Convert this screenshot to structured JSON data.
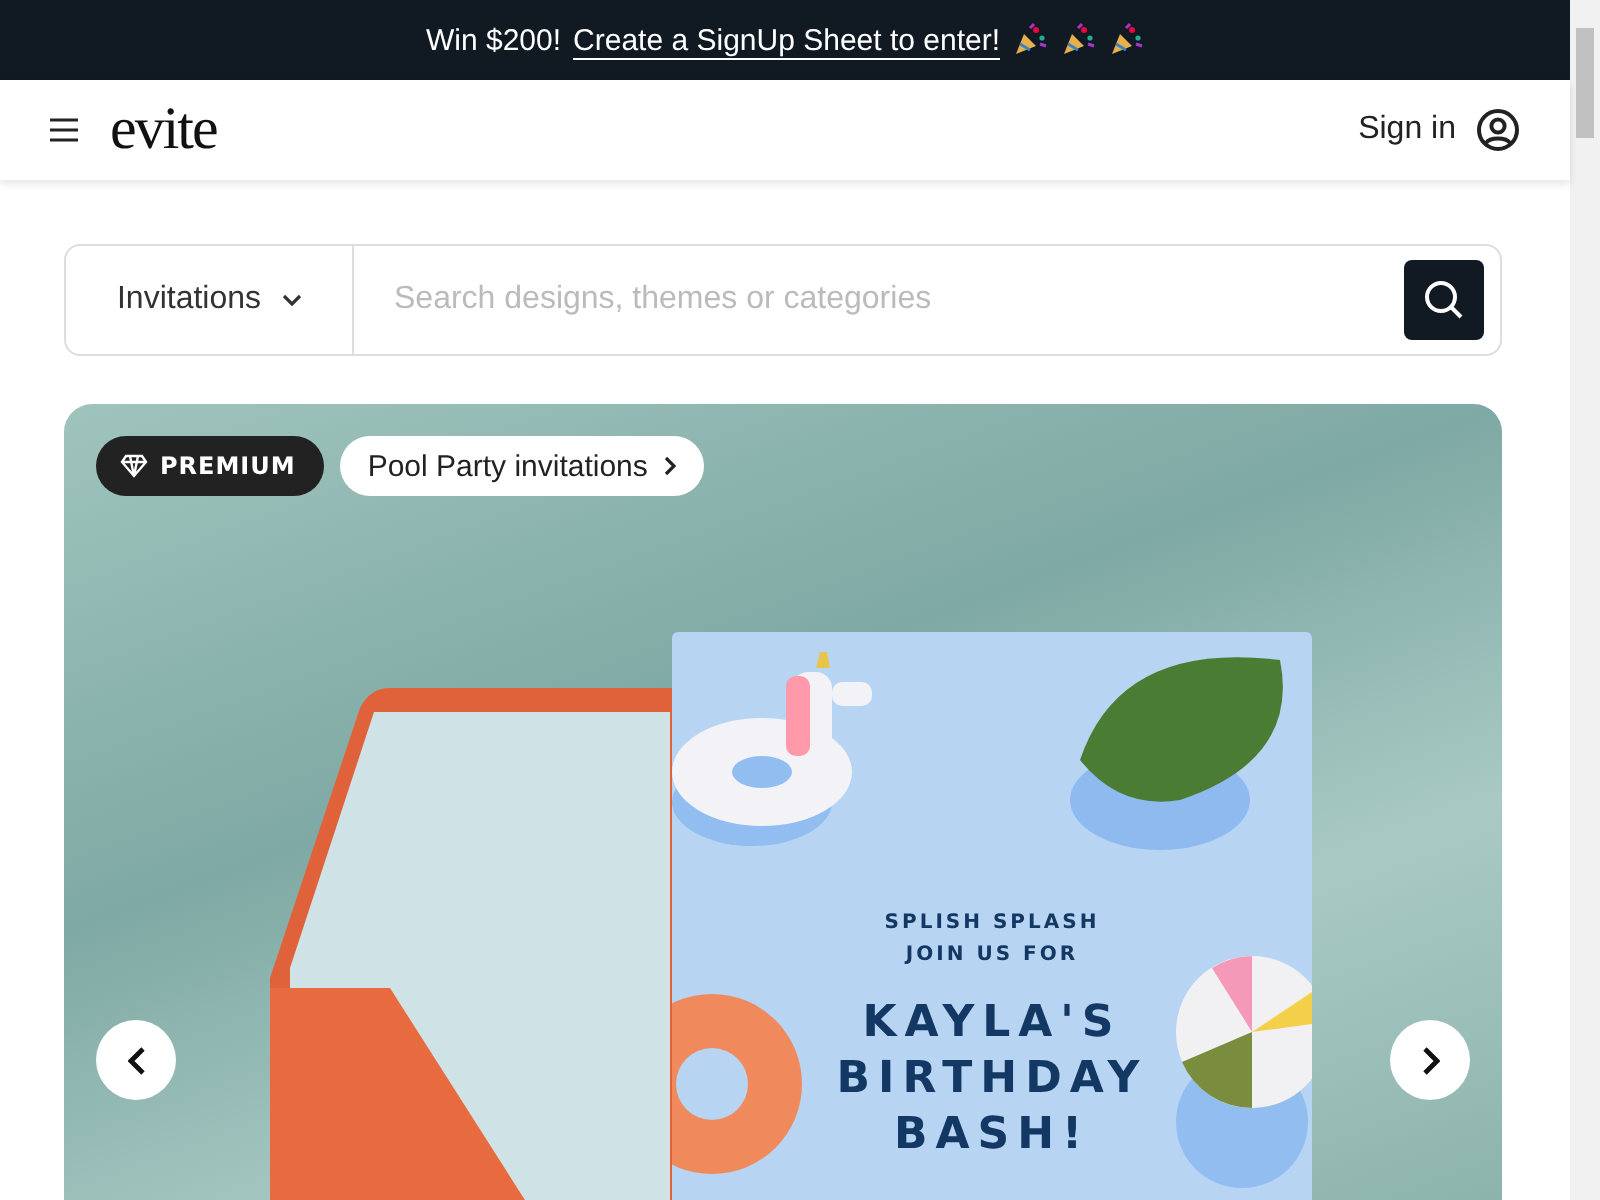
{
  "promo_banner": {
    "text": "Win $200!",
    "link": "Create a SignUp Sheet to enter!"
  },
  "header": {
    "logo": "evite",
    "sign_in": "Sign in"
  },
  "search": {
    "category": "Invitations",
    "placeholder": "Search designs, themes or categories"
  },
  "hero": {
    "badge": "PREMIUM",
    "category_link": "Pool Party invitations",
    "invitation": {
      "tagline": [
        "SPLISH SPLASH",
        "JOIN US FOR"
      ],
      "headline": [
        "KAYLA'S",
        "BIRTHDAY",
        "BASH!"
      ]
    }
  }
}
